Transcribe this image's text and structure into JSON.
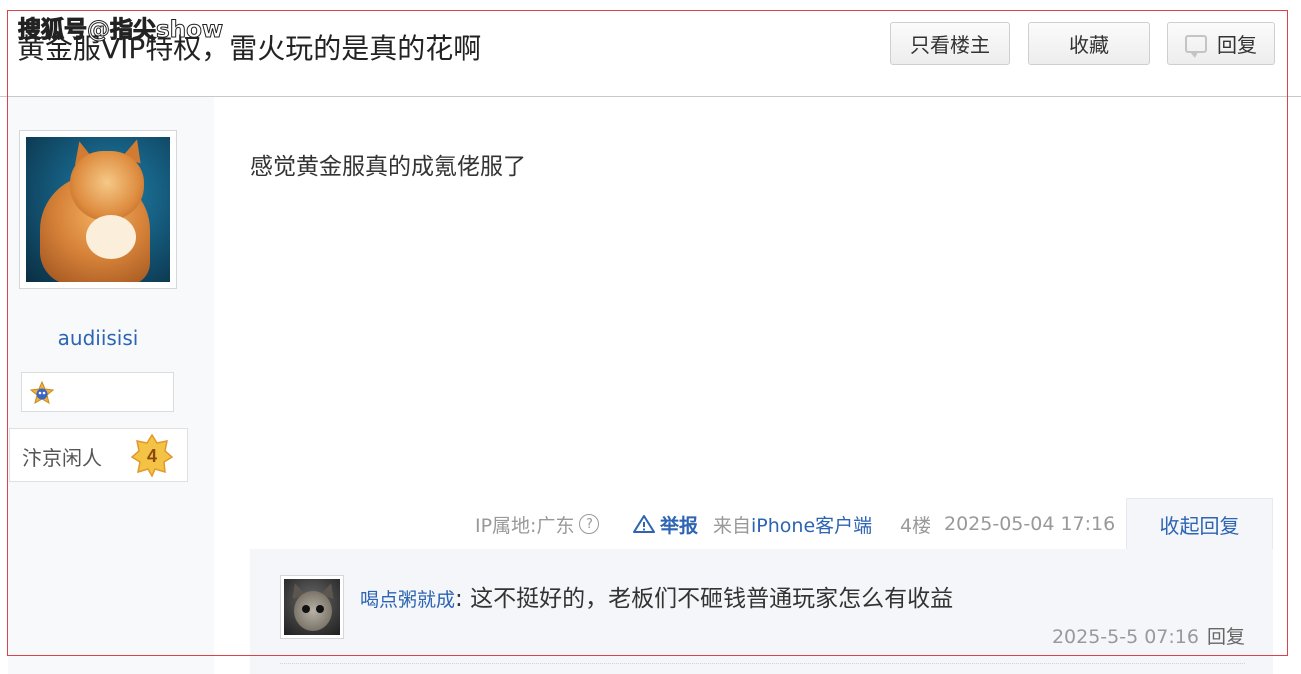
{
  "watermark": "搜狐号@指尖show",
  "header": {
    "title": "黄金服VIP特权，雷火玩的是真的花啊",
    "only_owner_label": "只看楼主",
    "favorite_label": "收藏",
    "reply_label": "回复",
    "reply_icon": "comment-bubble-icon"
  },
  "author": {
    "name": "audiisisi",
    "badge_icon": "star-badge-icon",
    "level_title": "汴京闲人",
    "level": "4"
  },
  "post": {
    "content": "感觉黄金服真的成氪佬服了",
    "ip_label": "IP属地:广东",
    "help_icon_char": "?",
    "report_label": "举报",
    "from_prefix": "来自",
    "client": "iPhone客户端",
    "floor": "4楼",
    "time": "2025-05-04 17:16",
    "collapse_label": "收起回复"
  },
  "replies": [
    {
      "user": "喝点粥就成",
      "separator": ": ",
      "text": "这不挺好的，老板们不砸钱普通玩家怎么有收益",
      "time": "2025-5-5 07:16",
      "reply_label": "回复"
    }
  ],
  "colors": {
    "link": "#2d64b3",
    "frame": "#d9434c",
    "muted": "#999999",
    "panel": "#f4f6f9"
  }
}
